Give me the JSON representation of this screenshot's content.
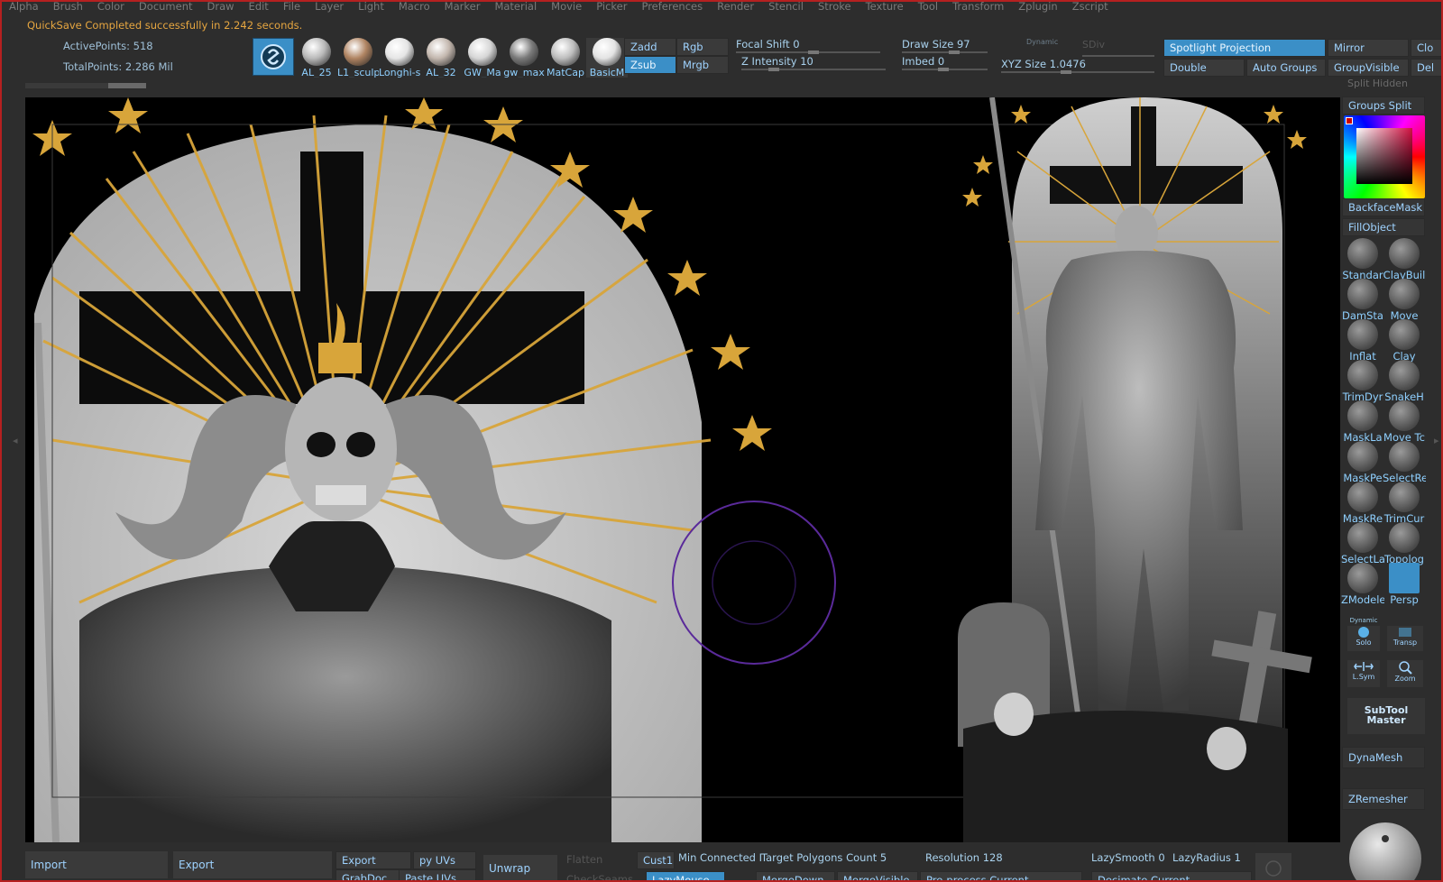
{
  "menu": [
    "Alpha",
    "Brush",
    "Color",
    "Document",
    "Draw",
    "Edit",
    "File",
    "Layer",
    "Light",
    "Macro",
    "Marker",
    "Material",
    "Movie",
    "Picker",
    "Preferences",
    "Render",
    "Stencil",
    "Stroke",
    "Texture",
    "Tool",
    "Transform",
    "Zplugin",
    "Zscript"
  ],
  "notice": "QuickSave Completed successfully in 2.242 seconds.",
  "stats": {
    "active_points": "ActivePoints: 518",
    "total_points": "TotalPoints: 2.286 Mil"
  },
  "materials": [
    {
      "label": "AL_25",
      "color": "#b9b9b9"
    },
    {
      "label": "L1_sculp",
      "color": "#b08462"
    },
    {
      "label": "Longhi-s",
      "color": "#e5e5e5"
    },
    {
      "label": "AL_32",
      "color": "#c3b7ae"
    },
    {
      "label": "GW_Ma",
      "color": "#d6d6d6"
    },
    {
      "label": "gw_max",
      "color": "#7a7a7a"
    },
    {
      "label": "MatCap",
      "color": "#bdbdbd"
    },
    {
      "label": "BasicM",
      "color": "#e3e3e3"
    }
  ],
  "toggles": {
    "zadd": "Zadd",
    "zsub": "Zsub",
    "rgb": "Rgb",
    "mrgb": "Mrgb"
  },
  "sliders": {
    "focal_shift": "Focal Shift 0",
    "z_intensity": "Z Intensity 10",
    "draw_size": "Draw Size 97",
    "dynamic": "Dynamic",
    "sdiv": "SDiv",
    "imbed": "Imbed 0",
    "xyz_size": "XYZ Size 1.0476"
  },
  "top_right": {
    "spotlight": "Spotlight Projection",
    "mirror": "Mirror",
    "clo": "Clo",
    "double": "Double",
    "auto_groups": "Auto Groups",
    "group_visible": "GroupVisible",
    "del": "Del"
  },
  "right_panel": {
    "split_hidden": "Split Hidden",
    "groups_split": "Groups Split",
    "backface_mask": "BackfaceMask",
    "fill_object": "FillObject",
    "tools": [
      [
        "Standar",
        "ClayBuil"
      ],
      [
        "DamSta",
        "Move"
      ],
      [
        "Inflat",
        "Clay"
      ],
      [
        "TrimDyr",
        "SnakeH"
      ],
      [
        "MaskLa",
        "Move Tc"
      ],
      [
        "MaskPe",
        "SelectRe"
      ],
      [
        "MaskRe",
        "TrimCur"
      ],
      [
        "SelectLa",
        "Topolog"
      ],
      [
        "ZModele",
        "Persp"
      ]
    ],
    "dynamic_label": "Dynamic",
    "solo": "Solo",
    "transp": "Transp",
    "lsym": "L.Sym",
    "zoom": "Zoom",
    "subtool_master_1": "SubTool",
    "subtool_master_2": "Master",
    "dynamesh": "DynaMesh",
    "zremesher": "ZRemesher"
  },
  "bottom": {
    "import": "Import",
    "export": "Export",
    "export2": "Export",
    "py_uvs": "py UVs",
    "unwrap": "Unwrap",
    "flatten": "Flatten",
    "cust1": "Cust1",
    "min_connected": "Min Connected I",
    "target_polygons": "Target Polygons Count 5",
    "resolution": "Resolution 128",
    "lazy_smooth": "LazySmooth 0",
    "lazy_radius": "LazyRadius 1",
    "grabdoc": "GrabDoc",
    "paste_uvs": "Paste UVs",
    "check_seams": "CheckSeams",
    "lazy_mouse": "LazyMouse",
    "merge_down": "MergeDown",
    "merge_visible": "MergeVisible",
    "preprocess": "Pre-process Current",
    "decimate": "Decimate Current"
  },
  "colors": {
    "accent": "#3b8fc7",
    "notice": "#e6a640",
    "gold": "#d8a53a"
  }
}
